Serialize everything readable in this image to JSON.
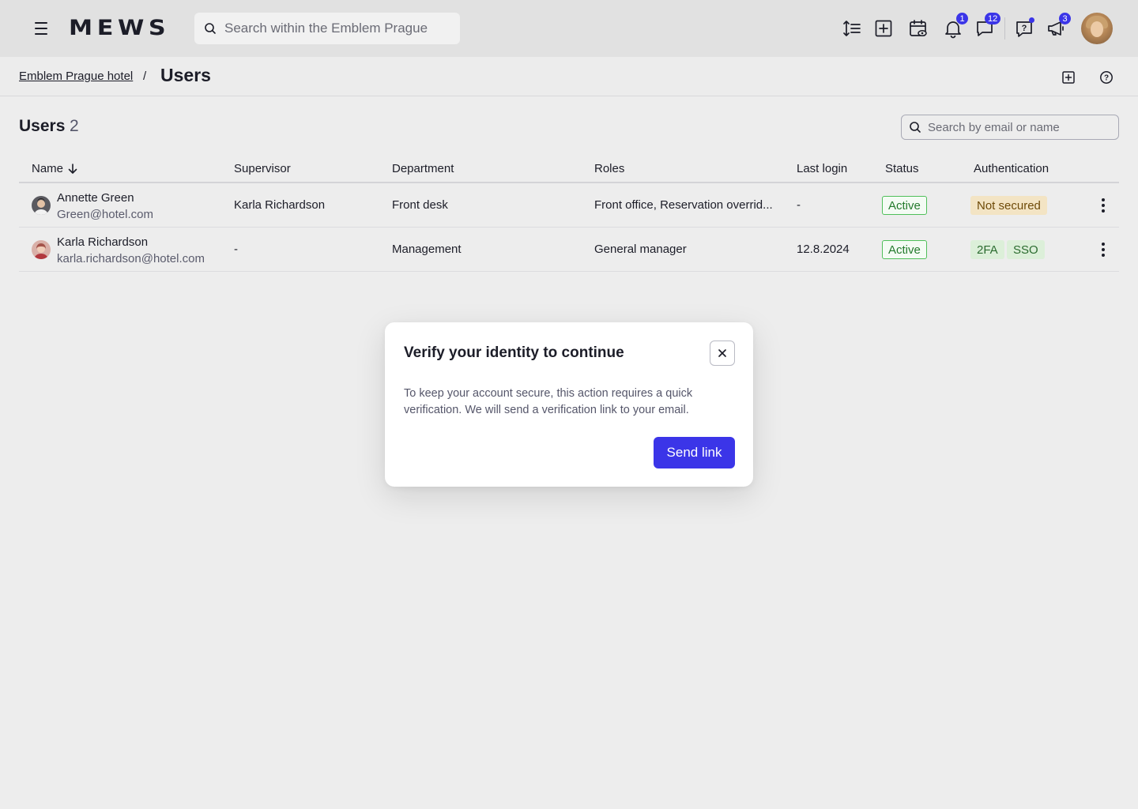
{
  "topbar": {
    "menu_icon": "hamburger-menu-icon",
    "logo": "MEWS",
    "search_placeholder": "Search within the Emblem Prague",
    "icons": [
      "line-height-icon",
      "add-square-icon",
      "calendar-view-icon",
      "bell-icon",
      "chat-icon",
      "help-question-icon",
      "megaphone-icon"
    ],
    "notifications_badge": "1",
    "messages_badge": "12",
    "announcements_badge": "3",
    "accent": "#3b35e8"
  },
  "breadcrumb": {
    "parent": "Emblem Prague hotel",
    "separator": "/",
    "current": "Users"
  },
  "users_section": {
    "title": "Users",
    "count": "2",
    "search_placeholder": "Search by email or name"
  },
  "table": {
    "columns": [
      "Name",
      "Supervisor",
      "Department",
      "Roles",
      "Last login",
      "Status",
      "Authentication"
    ],
    "sort_icon": "arrow-down-icon",
    "rows": [
      {
        "name": "Annette Green",
        "email": "Green@hotel.com",
        "supervisor": "Karla Richardson",
        "department": "Front desk",
        "roles": "Front office, Reservation overrid...",
        "last_login": "-",
        "status": "Active",
        "auth": [
          "Not secured"
        ]
      },
      {
        "name": "Karla Richardson",
        "email": "karla.richardson@hotel.com",
        "supervisor": "-",
        "department": "Management",
        "roles": "General manager",
        "last_login": "12.8.2024",
        "status": "Active",
        "auth": [
          "2FA",
          "SSO"
        ]
      }
    ]
  },
  "modal": {
    "title": "Verify your identity to continue",
    "body": "To keep your account secure, this action requires a quick verification. We will send a verification link to your email.",
    "button": "Send link",
    "close_icon": "close-icon"
  }
}
